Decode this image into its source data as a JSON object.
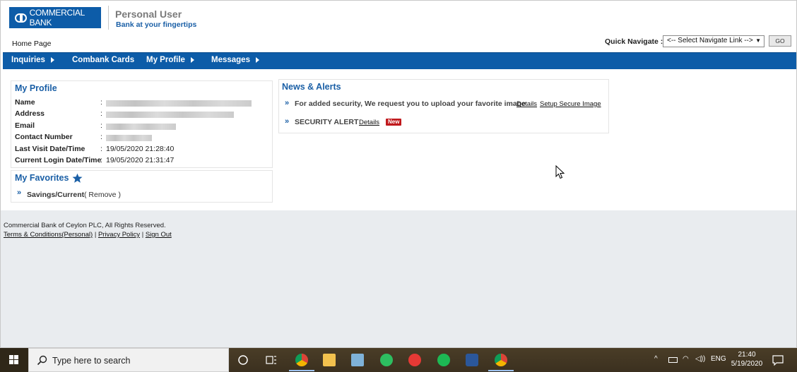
{
  "header": {
    "logo_text": "COMMERCIAL BANK",
    "title": "Personal User",
    "tagline": "Bank at your fingertips"
  },
  "breadcrumb": "Home Page",
  "quick_navigate": {
    "label": "Quick Navigate :",
    "selected": "<-- Select Navigate Link -->",
    "go_label": "GO"
  },
  "nav": {
    "items": [
      {
        "label": "Inquiries"
      },
      {
        "label": "Combank Cards"
      },
      {
        "label": "My Profile"
      },
      {
        "label": "Messages"
      }
    ]
  },
  "profile": {
    "title": "My Profile",
    "fields": [
      {
        "label": "Name",
        "value": ""
      },
      {
        "label": "Address",
        "value": ""
      },
      {
        "label": "Email",
        "value": ""
      },
      {
        "label": "Contact Number",
        "value": ""
      },
      {
        "label": "Last Visit Date/Time",
        "value": "19/05/2020 21:28:40"
      },
      {
        "label": "Current Login Date/Time",
        "value": "19/05/2020 21:31:47"
      }
    ]
  },
  "favorites": {
    "title": "My Favorites",
    "items": [
      {
        "label": "Savings/Current",
        "remove_label": "Remove"
      }
    ]
  },
  "news": {
    "title": "News & Alerts",
    "items": [
      {
        "text": "For added security, We request you to upload your favorite image",
        "link1": "Details",
        "link2": "Setup Secure Image"
      },
      {
        "text": "SECURITY ALERT",
        "link1": "Details",
        "badge": "New"
      }
    ]
  },
  "footer": {
    "copyright": "Commercial Bank of Ceylon PLC, All Rights Reserved.",
    "terms": "Terms & Conditions(Personal)",
    "privacy": "Privacy Policy",
    "signout": "Sign Out"
  },
  "taskbar": {
    "search_placeholder": "Type here to search",
    "language": "ENG",
    "time": "21:40",
    "date": "5/19/2020"
  },
  "colors": {
    "brand_blue": "#0d5ca8",
    "link_blue": "#1a5fa6",
    "badge_red": "#c0191d"
  }
}
